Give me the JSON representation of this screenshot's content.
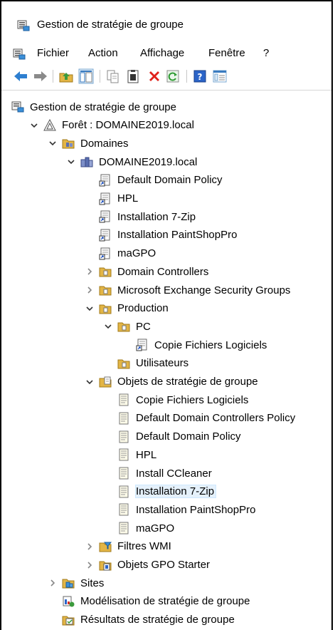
{
  "window": {
    "title": "Gestion de stratégie de groupe"
  },
  "menu": [
    "Fichier",
    "Action",
    "Affichage",
    "Fenêtre",
    "?"
  ],
  "toolbar": [
    "back-arrow-icon",
    "forward-arrow-icon",
    "up-folder-icon",
    "show-hide-tree-icon",
    "copy-icon",
    "paste-icon",
    "delete-icon",
    "refresh-icon",
    "help-icon",
    "properties-icon"
  ],
  "tree": [
    {
      "label": "Gestion de stratégie de groupe",
      "icon": "gpmc-icon",
      "expander": "none"
    },
    {
      "label": "Forêt : DOMAINE2019.local",
      "icon": "forest-icon",
      "expander": "expanded"
    },
    {
      "label": "Domaines",
      "icon": "domains-folder-icon",
      "expander": "expanded"
    },
    {
      "label": "DOMAINE2019.local",
      "icon": "domain-icon",
      "expander": "expanded"
    },
    {
      "label": "Default Domain Policy",
      "icon": "gpo-link-icon",
      "expander": "none"
    },
    {
      "label": "HPL",
      "icon": "gpo-link-icon",
      "expander": "none"
    },
    {
      "label": "Installation 7-Zip",
      "icon": "gpo-link-icon",
      "expander": "none"
    },
    {
      "label": "Installation PaintShopPro",
      "icon": "gpo-link-icon",
      "expander": "none"
    },
    {
      "label": "maGPO",
      "icon": "gpo-link-icon",
      "expander": "none"
    },
    {
      "label": "Domain Controllers",
      "icon": "ou-icon",
      "expander": "collapsed"
    },
    {
      "label": "Microsoft Exchange Security Groups",
      "icon": "ou-icon",
      "expander": "collapsed"
    },
    {
      "label": "Production",
      "icon": "ou-icon",
      "expander": "expanded"
    },
    {
      "label": "PC",
      "icon": "ou-icon",
      "expander": "expanded"
    },
    {
      "label": "Copie Fichiers Logiciels",
      "icon": "gpo-link-icon",
      "expander": "none"
    },
    {
      "label": "Utilisateurs",
      "icon": "ou-icon",
      "expander": "none"
    },
    {
      "label": "Objets de stratégie de groupe",
      "icon": "gpo-container-icon",
      "expander": "expanded"
    },
    {
      "label": "Copie Fichiers Logiciels",
      "icon": "gpo-icon",
      "expander": "none"
    },
    {
      "label": "Default Domain Controllers Policy",
      "icon": "gpo-icon",
      "expander": "none"
    },
    {
      "label": "Default Domain Policy",
      "icon": "gpo-icon",
      "expander": "none"
    },
    {
      "label": "HPL",
      "icon": "gpo-icon",
      "expander": "none"
    },
    {
      "label": "Install CCleaner",
      "icon": "gpo-icon",
      "expander": "none"
    },
    {
      "label": "Installation 7-Zip",
      "icon": "gpo-icon",
      "expander": "none",
      "selected": true
    },
    {
      "label": "Installation PaintShopPro",
      "icon": "gpo-icon",
      "expander": "none"
    },
    {
      "label": "maGPO",
      "icon": "gpo-icon",
      "expander": "none"
    },
    {
      "label": "Filtres WMI",
      "icon": "wmi-filter-icon",
      "expander": "collapsed"
    },
    {
      "label": "Objets GPO Starter",
      "icon": "starter-gpo-icon",
      "expander": "collapsed"
    },
    {
      "label": "Sites",
      "icon": "sites-icon",
      "expander": "collapsed"
    },
    {
      "label": "Modélisation de stratégie de groupe",
      "icon": "modeling-icon",
      "expander": "none"
    },
    {
      "label": "Résultats de stratégie de groupe",
      "icon": "results-icon",
      "expander": "none"
    }
  ]
}
